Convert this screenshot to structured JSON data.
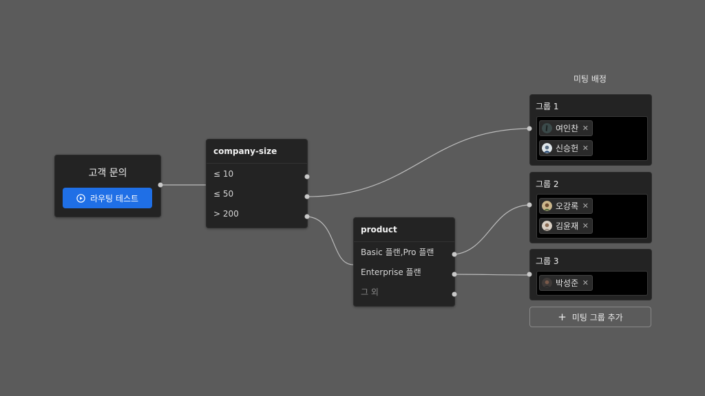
{
  "start_node": {
    "title": "고객 문의",
    "button_label": "라우팅 테스트"
  },
  "size_node": {
    "title": "company-size",
    "rows": [
      "≤ 10",
      "≤ 50",
      "> 200"
    ]
  },
  "product_node": {
    "title": "product",
    "rows": [
      "Basic 플랜,Pro 플랜",
      "Enterprise 플랜",
      "그 외"
    ]
  },
  "meeting": {
    "title": "미팅 배정",
    "groups": [
      {
        "title": "그룹 1",
        "members": [
          "여인찬",
          "신승헌"
        ]
      },
      {
        "title": "그룹 2",
        "members": [
          "오강록",
          "김윤재"
        ]
      },
      {
        "title": "그룹 3",
        "members": [
          "박성준"
        ]
      }
    ],
    "add_label": "미팅 그룹 추가"
  },
  "colors": {
    "background": "#5b5b5b",
    "node": "#232323",
    "accent": "#1f6fe6",
    "edge": "#bdbdbd"
  },
  "icons": {
    "play": "play-circle-icon",
    "remove": "close-icon",
    "add": "plus-icon"
  }
}
